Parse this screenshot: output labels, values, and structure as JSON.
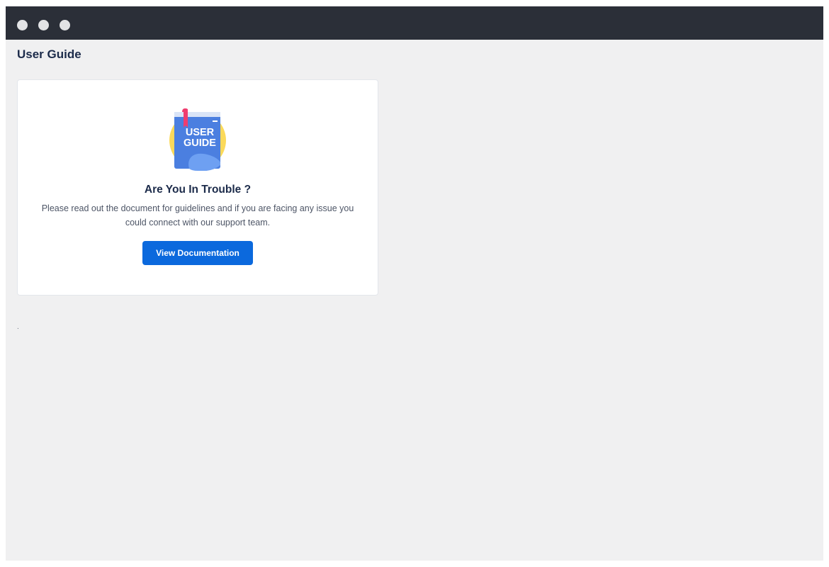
{
  "window": {
    "controls": [
      "close-dot",
      "minimize-dot",
      "maximize-dot"
    ]
  },
  "page": {
    "title": "User Guide"
  },
  "card": {
    "icon": "user-guide-book-icon",
    "icon_text_line1": "USER",
    "icon_text_line2": "GUIDE",
    "heading": "Are You In Trouble ?",
    "description": "Please read out the document for guidelines and if you are facing any issue you could connect with our support team.",
    "button_label": "View Documentation"
  },
  "footer": {
    "text": "."
  },
  "colors": {
    "titlebar": "#2b2f38",
    "background": "#f0f0f1",
    "primary_button": "#0b69dd",
    "heading_text": "#1c2b4a"
  }
}
